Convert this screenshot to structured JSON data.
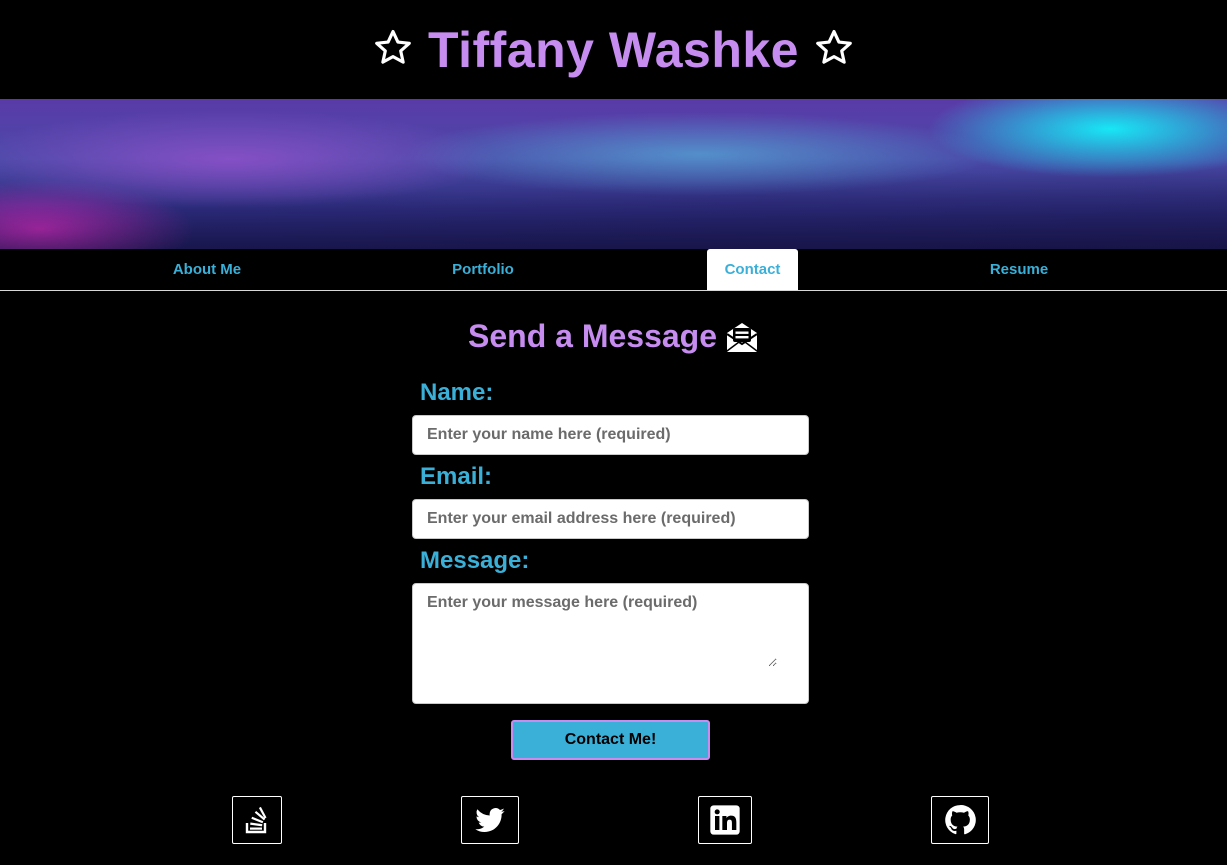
{
  "header": {
    "title": "Tiffany Washke",
    "left_icon": "star-icon",
    "right_icon": "star-icon",
    "title_color": "#c68cf0"
  },
  "nav": {
    "items": [
      {
        "label": "About Me",
        "active": false
      },
      {
        "label": "Portfolio",
        "active": false
      },
      {
        "label": "Contact",
        "active": true
      },
      {
        "label": "Resume",
        "active": false
      }
    ],
    "link_color": "#3ab0d8"
  },
  "form": {
    "heading": "Send a Message",
    "heading_icon": "envelope-open-icon",
    "name_label": "Name:",
    "name_placeholder": "Enter your name here (required)",
    "email_label": "Email:",
    "email_placeholder": "Enter your email address here (required)",
    "message_label": "Message:",
    "message_placeholder": "Enter your message here (required)",
    "submit_label": "Contact Me!"
  },
  "social": {
    "icons": [
      "stack-overflow-icon",
      "twitter-icon",
      "linkedin-icon",
      "github-icon"
    ]
  }
}
